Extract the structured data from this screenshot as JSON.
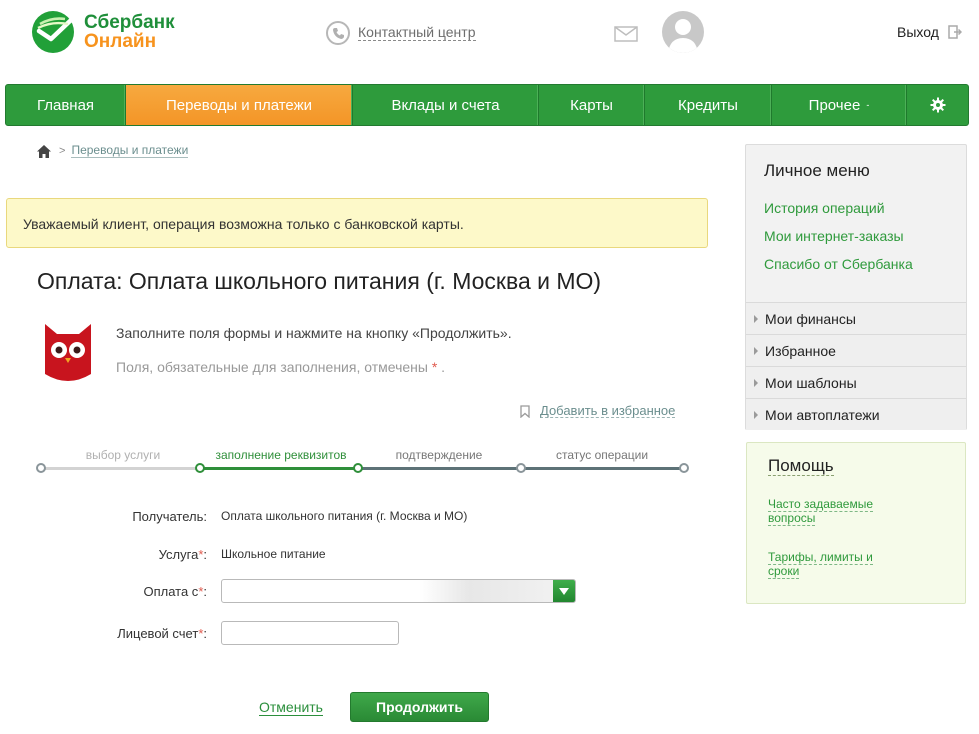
{
  "header": {
    "logo_line1": "Сбербанк",
    "logo_line2": "Онлайн",
    "contact_center": "Контактный центр",
    "logout": "Выход"
  },
  "colors": {
    "brand_green": "#2e9b3c",
    "brand_orange": "#f39527",
    "link_green": "#2f9a3c",
    "notice_bg": "#fdf9c9",
    "required_red": "#e05a4e"
  },
  "nav": {
    "items": [
      {
        "label": "Главная",
        "active": false
      },
      {
        "label": "Переводы и платежи",
        "active": true
      },
      {
        "label": "Вклады и счета",
        "active": false
      },
      {
        "label": "Карты",
        "active": false
      },
      {
        "label": "Кредиты",
        "active": false
      },
      {
        "label": "Прочее",
        "active": false
      }
    ],
    "caret": "-",
    "settings_icon": "gear-icon"
  },
  "breadcrumb": {
    "home_icon": "home-icon",
    "separator": ">",
    "current": "Переводы и платежи"
  },
  "notice": "Уважаемый клиент, операция возможна только с банковской карты.",
  "page_title": "Оплата: Оплата школьного питания (г. Москва и МО)",
  "hint": {
    "line1": "Заполните поля формы и нажмите на кнопку «Продолжить».",
    "line2": "Поля, обязательные для заполнения, отмечены",
    "required_mark": "*",
    "line2_end": "."
  },
  "favorite_link": "Добавить в избранное",
  "steps": [
    {
      "label": "выбор услуги",
      "state": "done"
    },
    {
      "label": "заполнение реквизитов",
      "state": "current"
    },
    {
      "label": "подтверждение",
      "state": "todo"
    },
    {
      "label": "статус операции",
      "state": "todo"
    }
  ],
  "form": {
    "recipient_label": "Получатель:",
    "recipient_value": "Оплата школьного питания (г. Москва и МО)",
    "service_label": "Услуга",
    "service_value": "Школьное питание",
    "payment_from_label": "Оплата с",
    "account_label": "Лицевой счет",
    "required_mark": "*",
    "colon": ":",
    "payment_from_value": "",
    "account_value": ""
  },
  "actions": {
    "cancel": "Отменить",
    "continue": "Продолжить"
  },
  "personal_menu": {
    "title": "Личное меню",
    "links": [
      "История операций",
      "Мои интернет-заказы",
      "Спасибо от Сбербанка"
    ],
    "sections": [
      "Мои финансы",
      "Избранное",
      "Мои шаблоны",
      "Мои автоплатежи"
    ]
  },
  "help": {
    "title": "Помощь",
    "links": [
      {
        "line1": "Часто задаваемые",
        "line2": "вопросы"
      },
      {
        "line1": "Тарифы, лимиты и",
        "line2": "сроки"
      }
    ]
  }
}
